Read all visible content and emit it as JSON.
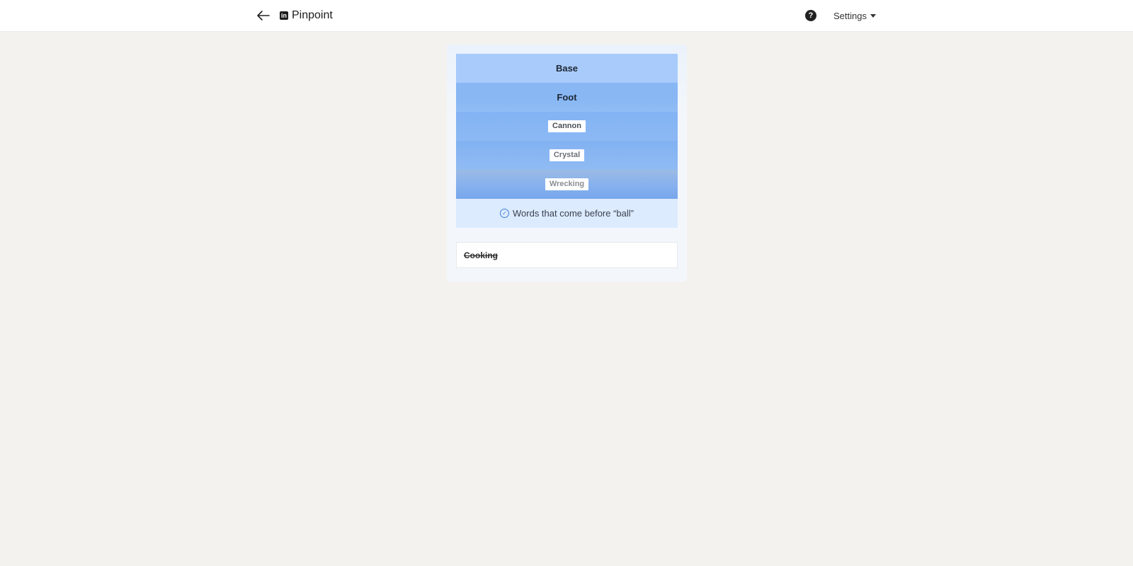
{
  "header": {
    "app_title": "Pinpoint",
    "settings_label": "Settings",
    "help_label": "?",
    "logo_text": "in"
  },
  "puzzle": {
    "clues": [
      {
        "text": "Base",
        "revealed": true
      },
      {
        "text": "Foot",
        "revealed": true
      },
      {
        "text": "Cannon",
        "revealed": false
      },
      {
        "text": "Crystal",
        "revealed": false
      },
      {
        "text": "Wrecking",
        "revealed": false
      }
    ],
    "answer": "Words that come before “ball”",
    "guesses": [
      "Cooking"
    ]
  },
  "colors": {
    "accent": "#3f7fdc",
    "answer_bg": "#dcebfd",
    "page_bg": "#f3f2ef"
  }
}
